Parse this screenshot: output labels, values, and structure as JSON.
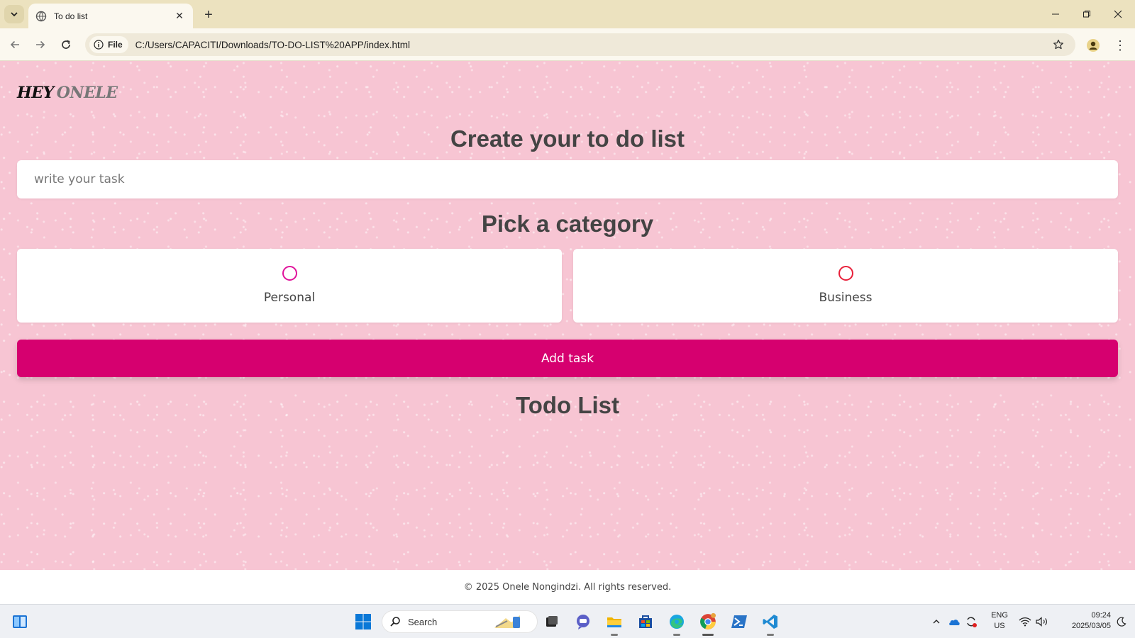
{
  "browser": {
    "tab_title": "To do list",
    "file_chip_label": "File",
    "url": "C:/Users/CAPACITI/Downloads/TO-DO-LIST%20APP/index.html"
  },
  "page": {
    "logo_word1": "HEY",
    "logo_word2": "ONELE",
    "create_heading": "Create your to do list",
    "task_input_placeholder": "write your task",
    "task_input_value": "",
    "category_heading": "Pick a category",
    "categories": [
      {
        "label": "Personal",
        "color": "#e0129b",
        "selected": false
      },
      {
        "label": "Business",
        "color": "#e8203a",
        "selected": false
      }
    ],
    "add_button_label": "Add task",
    "add_button_color": "#d6006f",
    "todo_heading": "Todo List",
    "todo_items": []
  },
  "footer": {
    "text": "© 2025 Onele Nongindzi. All rights reserved."
  },
  "taskbar": {
    "search_label": "Search",
    "language_line1": "ENG",
    "language_line2": "US",
    "time": "09:24",
    "date": "2025/03/05"
  }
}
